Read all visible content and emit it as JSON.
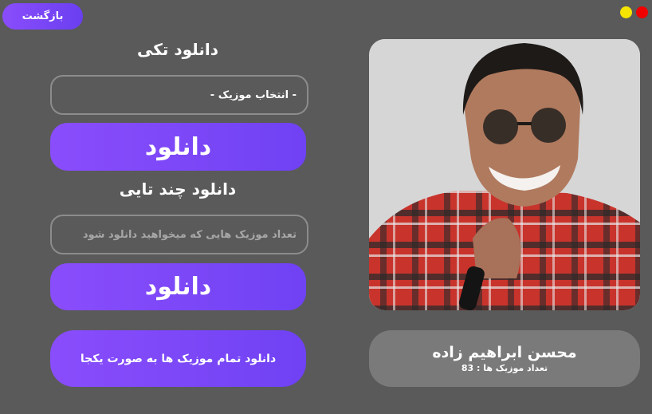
{
  "header": {
    "back_label": "بازگشت"
  },
  "window_controls": {
    "minimize_color": "#f5e400",
    "close_color": "#f10000"
  },
  "single": {
    "heading": "دانلود تکی",
    "select_value": "- انتخاب موزیک -",
    "download_label": "دانلود"
  },
  "multi": {
    "heading": "دانلود چند تایی",
    "input_placeholder": "تعداد موزیک هایی که میخواهید دانلود شود",
    "download_label": "دانلود"
  },
  "all": {
    "label": "دانلود تمام موزیک ها به صورت یکجا"
  },
  "artist": {
    "name": "محسن ابراهیم زاده",
    "count_text": "تعداد موزیک ها : 83"
  },
  "colors": {
    "background": "#5a5a5a",
    "accent_start": "#8a4dfc",
    "accent_end": "#6f42f3",
    "card": "#7a7a7a"
  }
}
